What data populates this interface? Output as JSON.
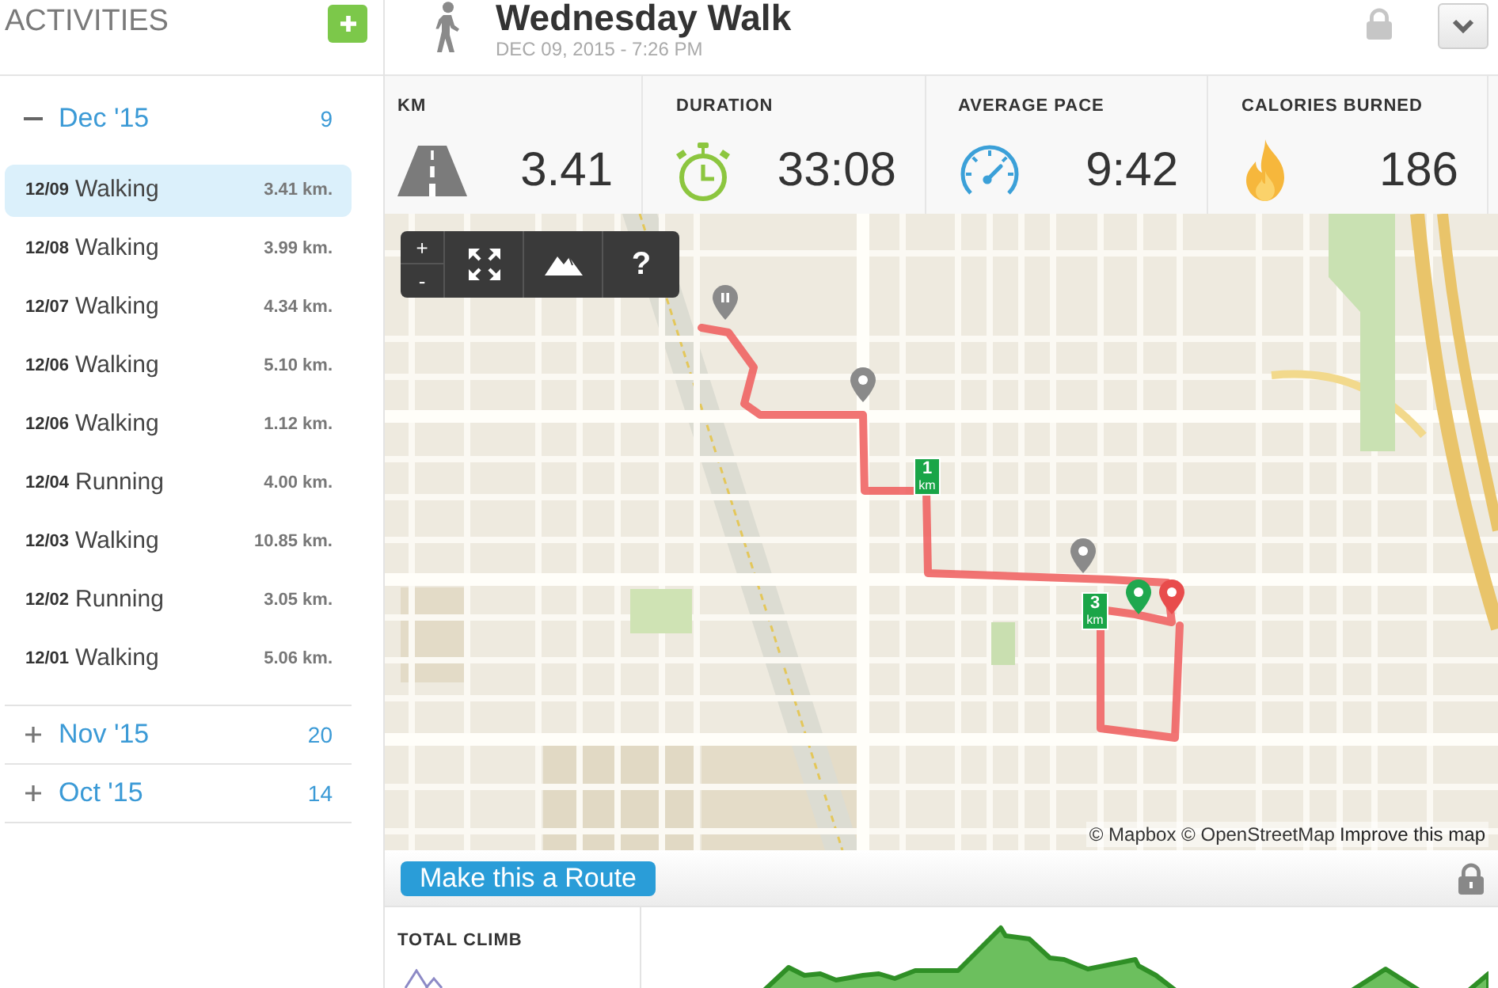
{
  "sidebar": {
    "title": "ACTIVITIES",
    "groups": [
      {
        "label": "Dec '15",
        "count": "9",
        "expanded": true,
        "activities": [
          {
            "date": "12/09",
            "type": "Walking",
            "distance": "3.41 km.",
            "selected": true
          },
          {
            "date": "12/08",
            "type": "Walking",
            "distance": "3.99 km.",
            "selected": false
          },
          {
            "date": "12/07",
            "type": "Walking",
            "distance": "4.34 km.",
            "selected": false
          },
          {
            "date": "12/06",
            "type": "Walking",
            "distance": "5.10 km.",
            "selected": false
          },
          {
            "date": "12/06",
            "type": "Walking",
            "distance": "1.12 km.",
            "selected": false
          },
          {
            "date": "12/04",
            "type": "Running",
            "distance": "4.00 km.",
            "selected": false
          },
          {
            "date": "12/03",
            "type": "Walking",
            "distance": "10.85 km.",
            "selected": false
          },
          {
            "date": "12/02",
            "type": "Running",
            "distance": "3.05 km.",
            "selected": false
          },
          {
            "date": "12/01",
            "type": "Walking",
            "distance": "5.06 km.",
            "selected": false
          }
        ]
      },
      {
        "label": "Nov '15",
        "count": "20",
        "expanded": false
      },
      {
        "label": "Oct '15",
        "count": "14",
        "expanded": false
      }
    ]
  },
  "activity": {
    "title": "Wednesday Walk",
    "datetime": "DEC 09, 2015 - 7:26 PM"
  },
  "stats": [
    {
      "kind": "distance",
      "label": "KM",
      "value": "3.41"
    },
    {
      "kind": "duration",
      "label": "DURATION",
      "value": "33:08"
    },
    {
      "kind": "pace",
      "label": "AVERAGE PACE",
      "value": "9:42"
    },
    {
      "kind": "calories",
      "label": "CALORIES BURNED",
      "value": "186"
    }
  ],
  "map": {
    "controls": {
      "zoom_in": "+",
      "zoom_out": "-",
      "help": "?"
    },
    "km_markers": [
      {
        "value": "1",
        "unit": "km"
      },
      {
        "value": "3",
        "unit": "km"
      }
    ],
    "attribution": "© Mapbox © OpenStreetMap",
    "attribution_link": "Improve this map"
  },
  "route_button": "Make this a Route",
  "total_climb": {
    "label": "TOTAL CLIMB"
  }
}
